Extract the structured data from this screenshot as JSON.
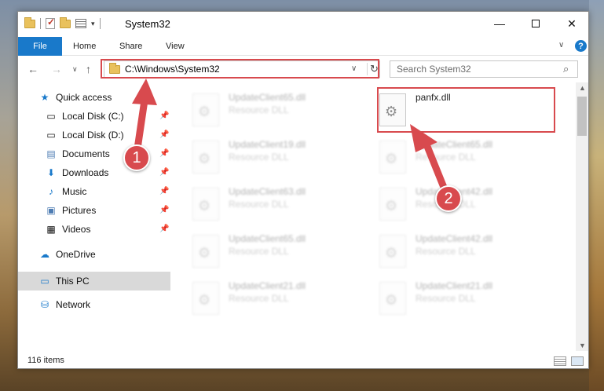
{
  "window": {
    "title": "System32"
  },
  "ribbon": {
    "file": "File",
    "home": "Home",
    "share": "Share",
    "view": "View"
  },
  "address": {
    "path": "C:\\Windows\\System32"
  },
  "search": {
    "placeholder": "Search System32"
  },
  "sidebar": {
    "items": [
      {
        "label": "Quick access",
        "icon": "star-icon"
      },
      {
        "label": "Local Disk (C:)",
        "icon": "drive-icon"
      },
      {
        "label": "Local Disk (D:)",
        "icon": "drive-icon"
      },
      {
        "label": "Documents",
        "icon": "documents-icon"
      },
      {
        "label": "Downloads",
        "icon": "download-icon"
      },
      {
        "label": "Music",
        "icon": "music-icon"
      },
      {
        "label": "Pictures",
        "icon": "pictures-icon"
      },
      {
        "label": "Videos",
        "icon": "videos-icon"
      },
      {
        "label": "OneDrive",
        "icon": "cloud-icon"
      },
      {
        "label": "This PC",
        "icon": "computer-icon"
      },
      {
        "label": "Network",
        "icon": "network-icon"
      }
    ]
  },
  "files": [
    {
      "name": "UpdateClient65.dll",
      "type": "Resource DLL"
    },
    {
      "name": "panfx.dll",
      "type": ""
    },
    {
      "name": "UpdateClient19.dll",
      "type": "Resource DLL"
    },
    {
      "name": "UpdateClient65.dll",
      "type": "Resource DLL"
    },
    {
      "name": "UpdateClient63.dll",
      "type": "Resource DLL"
    },
    {
      "name": "UpdateClient42.dll",
      "type": "Resource DLL"
    },
    {
      "name": "UpdateClient65.dll",
      "type": "Resource DLL"
    },
    {
      "name": "UpdateClient42.dll",
      "type": "Resource DLL"
    },
    {
      "name": "UpdateClient21.dll",
      "type": "Resource DLL"
    },
    {
      "name": "UpdateClient21.dll",
      "type": "Resource DLL"
    }
  ],
  "status": {
    "count": "116 items"
  },
  "annotations": {
    "step1": "1",
    "step2": "2",
    "color": "#d84a4e"
  }
}
